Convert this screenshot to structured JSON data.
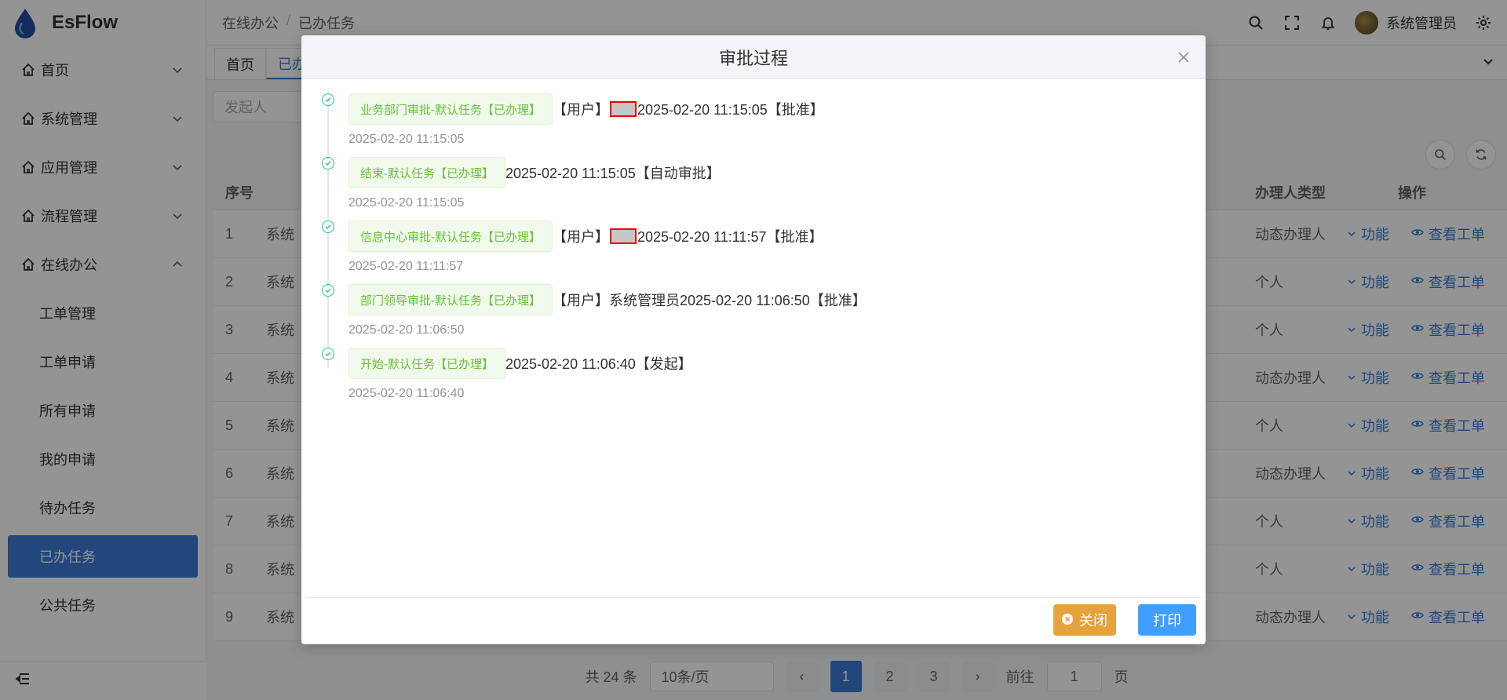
{
  "app": {
    "name": "EsFlow"
  },
  "sidebar": {
    "items": [
      {
        "label": "首页",
        "icon": "home-icon",
        "chevron": "down"
      },
      {
        "label": "系统管理",
        "icon": "home-icon",
        "chevron": "down"
      },
      {
        "label": "应用管理",
        "icon": "home-icon",
        "chevron": "down"
      },
      {
        "label": "流程管理",
        "icon": "home-icon",
        "chevron": "down"
      },
      {
        "label": "在线办公",
        "icon": "home-icon",
        "chevron": "up"
      }
    ],
    "sub_items": [
      "工单管理",
      "工单申请",
      "所有申请",
      "我的申请",
      "待办任务",
      "已办任务",
      "公共任务"
    ],
    "active_sub": "已办任务"
  },
  "header": {
    "breadcrumb": [
      "在线办公",
      "已办任务"
    ],
    "user": "系统管理员"
  },
  "tabs": [
    "首页",
    "已办"
  ],
  "filter": {
    "placeholder": "发起人"
  },
  "table": {
    "headers": {
      "no": "序号",
      "type": "办理人类型",
      "op": "操作"
    },
    "rows": [
      {
        "no": "1",
        "a": "系统",
        "type": "动态办理人"
      },
      {
        "no": "2",
        "a": "系统",
        "type": "个人"
      },
      {
        "no": "3",
        "a": "系统",
        "type": "个人"
      },
      {
        "no": "4",
        "a": "系统",
        "type": "动态办理人"
      },
      {
        "no": "5",
        "a": "系统",
        "type": "个人"
      },
      {
        "no": "6",
        "a": "系统",
        "type": "动态办理人"
      },
      {
        "no": "7",
        "a": "系统",
        "type": "个人"
      },
      {
        "no": "8",
        "a": "系统",
        "type": "个人"
      },
      {
        "no": "9",
        "a": "系统",
        "type": "动态办理人"
      }
    ],
    "op_func": "功能",
    "op_view": "查看工单"
  },
  "pagination": {
    "total": "共 24 条",
    "page_size": "10条/页",
    "pages": [
      "1",
      "2",
      "3"
    ],
    "current": "1",
    "goto_prefix": "前往",
    "goto_value": "1",
    "goto_suffix": "页"
  },
  "dialog": {
    "title": "审批过程",
    "timeline": [
      {
        "tag": "业务部门审批-默认任务【已办理】",
        "pre": "【用户】",
        "redacted": true,
        "text": "2025-02-20 11:15:05【批准】",
        "time": "2025-02-20 11:15:05"
      },
      {
        "tag": "结束-默认任务【已办理】",
        "pre": "",
        "redacted": false,
        "text": "2025-02-20 11:15:05【自动审批】",
        "time": "2025-02-20 11:15:05"
      },
      {
        "tag": "信息中心审批-默认任务【已办理】",
        "pre": "【用户】",
        "redacted": true,
        "text": "2025-02-20 11:11:57【批准】",
        "time": "2025-02-20 11:11:57"
      },
      {
        "tag": "部门领导审批-默认任务【已办理】",
        "pre": "【用户】系统管理员",
        "redacted": false,
        "text": "2025-02-20 11:06:50【批准】",
        "time": "2025-02-20 11:06:50"
      },
      {
        "tag": "开始-默认任务【已办理】",
        "pre": "",
        "redacted": false,
        "text": "2025-02-20 11:06:40【发起】",
        "time": "2025-02-20 11:06:40"
      }
    ],
    "close_label": "关闭",
    "print_label": "打印"
  },
  "colors": {
    "primary": "#3a7bd5",
    "success_tag_bg": "#f0f9eb",
    "success_tag_text": "#67c23a",
    "warning": "#e6a23c",
    "print": "#409eff",
    "dot": "#27c48a"
  }
}
